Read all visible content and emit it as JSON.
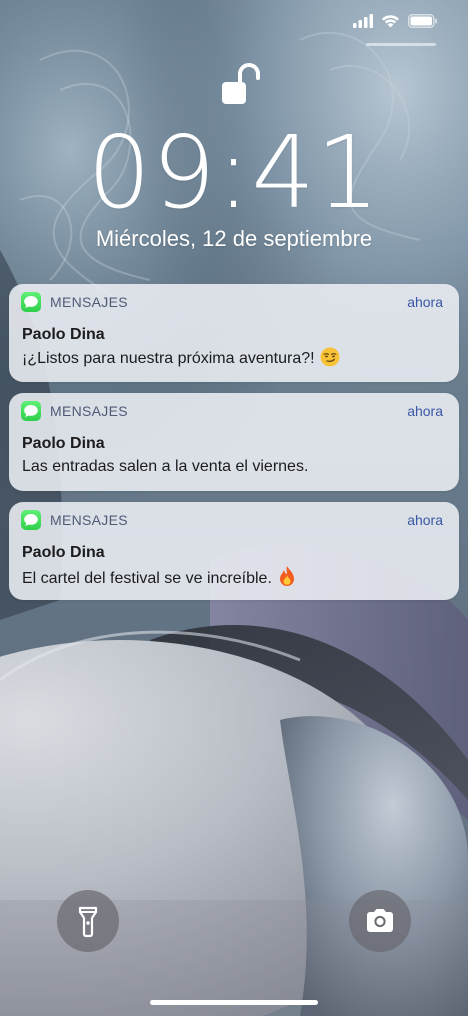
{
  "status_bar": {
    "icons": [
      "cellular-signal-icon",
      "wifi-icon",
      "battery-icon"
    ]
  },
  "lockscreen": {
    "lock_state_icon": "unlocked-padlock-icon",
    "time": "09:41",
    "date": "Miércoles, 12 de septiembre"
  },
  "notifications": [
    {
      "app": "MENSAJES",
      "time": "ahora",
      "sender": "Paolo Dina",
      "message": "¡¿Listos para nuestra próxima aventura?!",
      "emoji": "smirking-face-emoji"
    },
    {
      "app": "MENSAJES",
      "time": "ahora",
      "sender": "Paolo Dina",
      "message": "Las entradas salen a la venta el viernes."
    },
    {
      "app": "MENSAJES",
      "time": "ahora",
      "sender": "Paolo Dina",
      "message": "El cartel del festival se ve increíble.",
      "emoji": "fire-emoji"
    }
  ],
  "quick_actions": {
    "left_icon": "flashlight-icon",
    "right_icon": "camera-icon"
  },
  "colors": {
    "app_icon_green": "#34c759",
    "timestamp_blue": "#3a57a6",
    "notification_background": "#eceef4"
  }
}
